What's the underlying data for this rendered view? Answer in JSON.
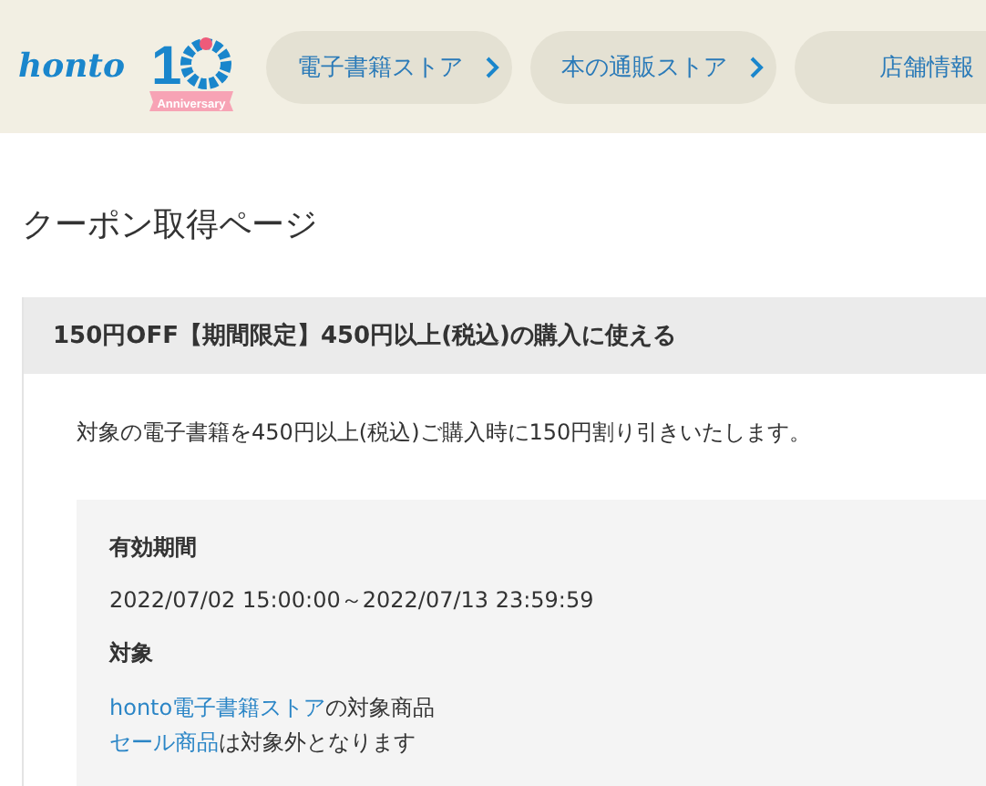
{
  "header": {
    "logo": "honto",
    "badge": {
      "number": "1",
      "ribbon": "Anniversary"
    },
    "nav": [
      {
        "label": "電子書籍ストア",
        "chevron": true
      },
      {
        "label": "本の通販ストア",
        "chevron": true
      },
      {
        "label": "店舗情報",
        "chevron": false
      }
    ]
  },
  "page_title": "クーポン取得ページ",
  "coupon": {
    "title": "150円OFF【期間限定】450円以上(税込)の購入に使える",
    "description": "対象の電子書籍を450円以上(税込)ご購入時に150円割り引きいたします。",
    "details": [
      {
        "kind": "heading",
        "text": "有効期間"
      },
      {
        "kind": "text",
        "text": "2022/07/02 15:00:00～2022/07/13 23:59:59"
      },
      {
        "kind": "heading",
        "text": "対象"
      },
      {
        "kind": "link_line",
        "link": "honto電子書籍ストア",
        "text": "の対象商品"
      },
      {
        "kind": "link_line",
        "link": "セール商品",
        "text": "は対象外となります"
      }
    ]
  }
}
